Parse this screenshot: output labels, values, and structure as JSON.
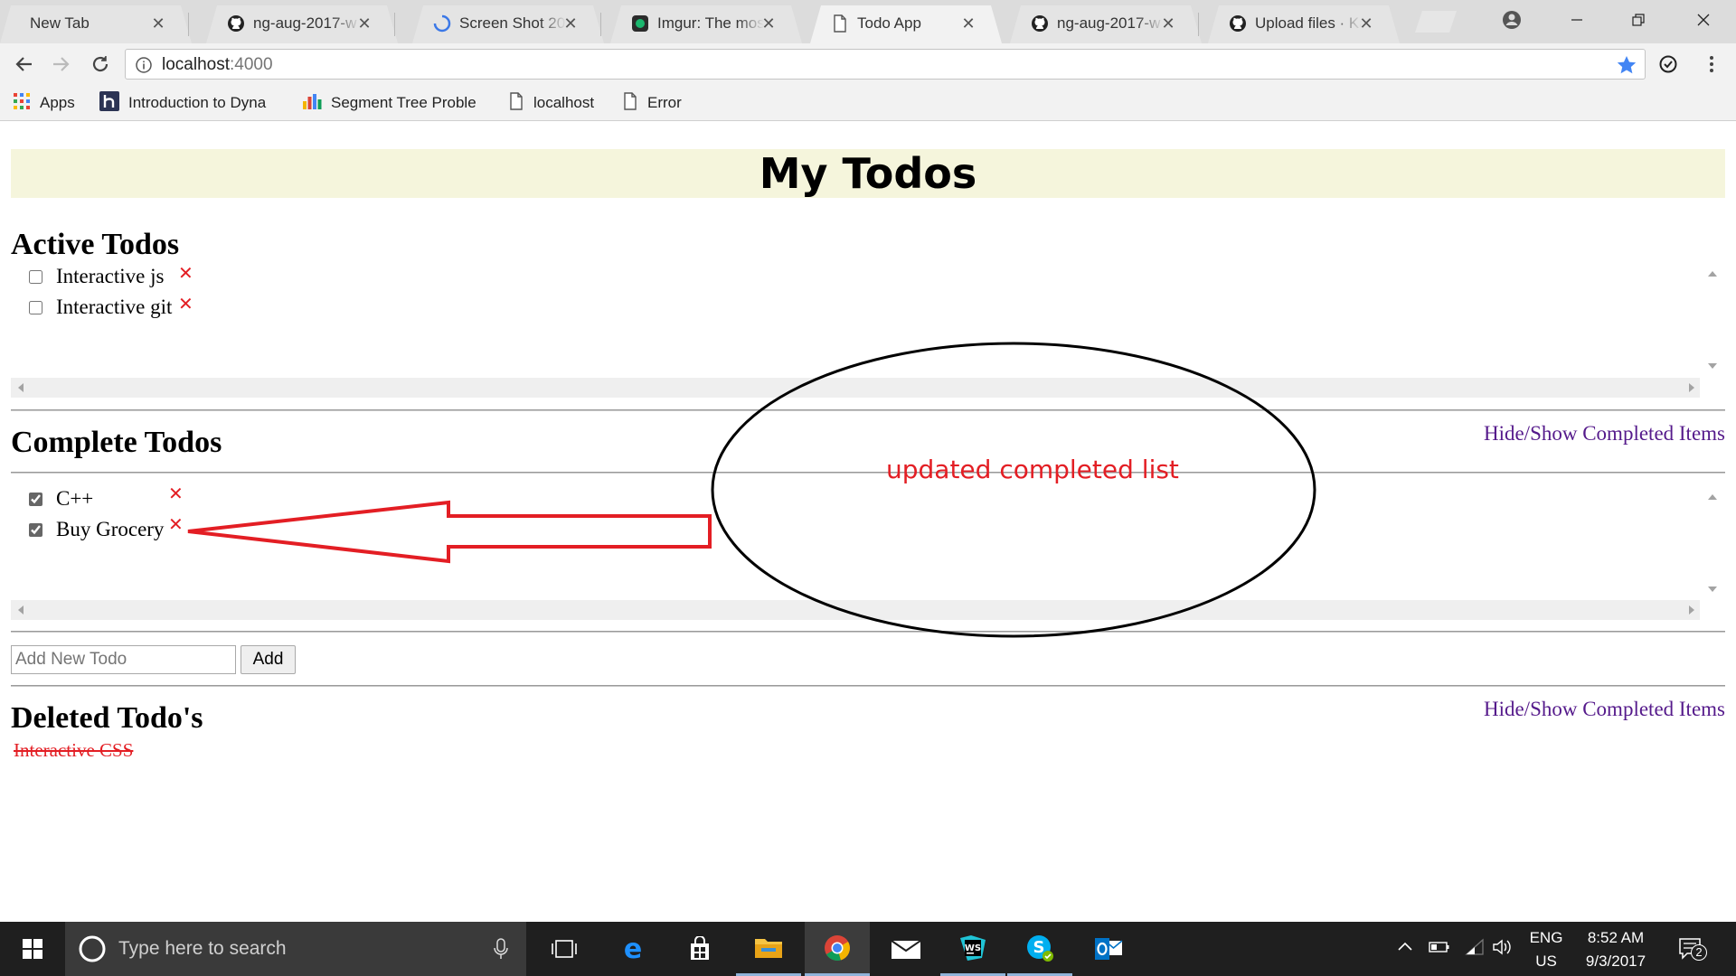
{
  "browser": {
    "tabs": [
      {
        "title": "New Tab",
        "icon": "blank-page-icon"
      },
      {
        "title": "ng-aug-2017-w",
        "icon": "github-icon"
      },
      {
        "title": "Screen Shot 201",
        "icon": "loading-spinner-icon"
      },
      {
        "title": "Imgur: The most",
        "icon": "imgur-icon"
      },
      {
        "title": "Todo App",
        "icon": "page-icon"
      },
      {
        "title": "ng-aug-2017-w",
        "icon": "github-icon"
      },
      {
        "title": "Upload files · Ka",
        "icon": "github-icon"
      }
    ],
    "active_tab": 4,
    "url_host": "localhost",
    "url_port": ":4000",
    "bookmarks": [
      {
        "label": "Apps",
        "icon": "apps-grid-icon"
      },
      {
        "label": "Introduction to Dyna",
        "icon": "hackerearth-icon"
      },
      {
        "label": "Segment Tree Proble",
        "icon": "bar-chart-icon"
      },
      {
        "label": "localhost",
        "icon": "page-icon"
      },
      {
        "label": "Error",
        "icon": "page-icon"
      }
    ]
  },
  "app": {
    "title": "My Todos",
    "active_heading": "Active Todos",
    "active_todos": [
      {
        "text": "Interactive js",
        "checked": false
      },
      {
        "text": "Interactive git",
        "checked": false
      }
    ],
    "complete_heading": "Complete Todos",
    "complete_todos": [
      {
        "text": "C++",
        "checked": true
      },
      {
        "text": "Buy Grocery",
        "checked": true
      }
    ],
    "toggle_link": "Hide/Show Completed Items",
    "new_todo_placeholder": "Add New Todo",
    "add_button": "Add",
    "deleted_heading": "Deleted Todo's",
    "deleted_todos": [
      "Interactive CSS"
    ],
    "delete_glyph": "✕"
  },
  "annotation": {
    "text": "updated completed list",
    "color": "#e31e24"
  },
  "taskbar": {
    "search_placeholder": "Type here to search",
    "language": "ENG",
    "region": "US",
    "time": "8:52 AM",
    "date": "9/3/2017",
    "notification_count": "2"
  }
}
